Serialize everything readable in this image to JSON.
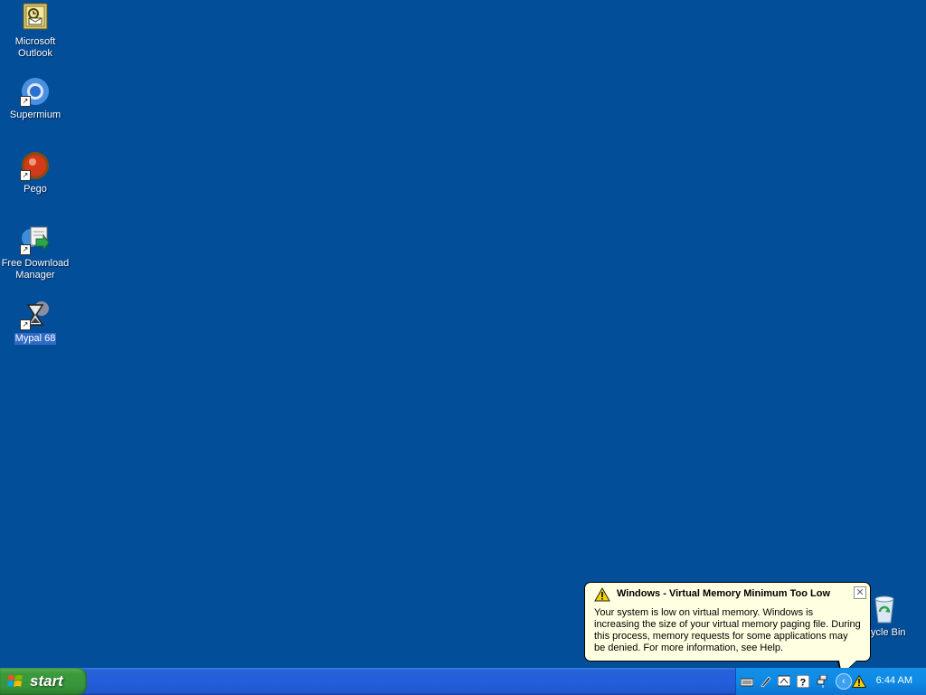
{
  "desktop": {
    "icons": [
      {
        "label_line1": "Microsoft",
        "label_line2": "Outlook",
        "icon": "outlook-icon"
      },
      {
        "label_line1": "Supermium",
        "label_line2": "",
        "icon": "supermium-icon"
      },
      {
        "label_line1": "Pego",
        "label_line2": "",
        "icon": "pego-icon"
      },
      {
        "label_line1": "Free Download",
        "label_line2": "Manager",
        "icon": "fdm-icon"
      },
      {
        "label_line1": "Mypal 68",
        "label_line2": "",
        "icon": "mypal-icon"
      },
      {
        "label_line1": "ycle Bin",
        "label_line2": "",
        "icon": "recycle-bin-icon"
      }
    ]
  },
  "balloon": {
    "title": "Windows - Virtual Memory Minimum Too Low",
    "body": "Your system is low on virtual memory. Windows is increasing the size of your virtual memory paging file. During this process, memory requests for some applications may be denied. For more information, see Help.",
    "close_glyph": "✕"
  },
  "taskbar": {
    "start_label": "start",
    "clock": "6:44 AM",
    "tray_icons": [
      "keyboard-icon",
      "pen-icon",
      "language-icon",
      "help-icon",
      "network-icon",
      "show-hidden-icons-icon",
      "warning-icon"
    ]
  },
  "colors": {
    "desktop": "#024e98",
    "taskbar": "#245edc",
    "start": "#36953a",
    "balloon": "#ffffe1"
  }
}
